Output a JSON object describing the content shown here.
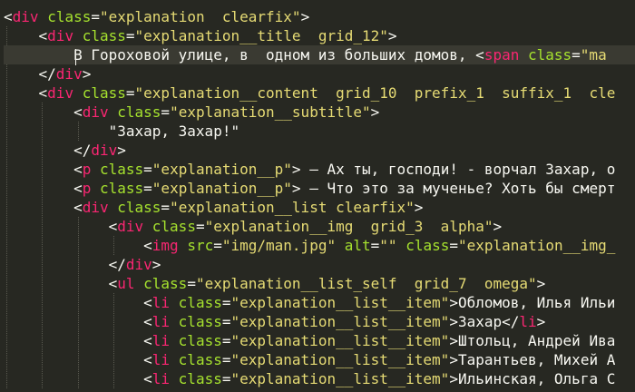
{
  "editor": {
    "colors": {
      "background": "#272822",
      "text": "#f8f8f2",
      "tag": "#f92672",
      "attribute": "#a6e22e",
      "string": "#e6db74"
    },
    "lines": [
      {
        "text": "<div class=\"explanation  clearfix\">"
      },
      {
        "text": "    <div class=\"explanation__title  grid_12\">"
      },
      {
        "text": "        В Гороховой улице, в  одном из больших домов, <span class=\"ma"
      },
      {
        "text": "    </div>"
      },
      {
        "text": "    <div class=\"explanation__content  grid_10  prefix_1  suffix_1  cle"
      },
      {
        "text": "        <div class=\"explanation__subtitle\">"
      },
      {
        "text": "            \"Захар, Захар!\""
      },
      {
        "text": "        </div>"
      },
      {
        "text": "        <p class=\"explanation__p\"> — Ах ты, господи! - ворчал Захар, о"
      },
      {
        "text": "        <p class=\"explanation__p\"> — Что это за мученье? Хоть бы смерт"
      },
      {
        "text": "        <div class=\"explanation__list clearfix\">"
      },
      {
        "text": "            <div class=\"explanation__img  grid_3  alpha\">"
      },
      {
        "text": "                <img src=\"img/man.jpg\" alt=\"\" class=\"explanation__img_"
      },
      {
        "text": "            </div>"
      },
      {
        "text": "            <ul class=\"explanation__list_self  grid_7  omega\">"
      },
      {
        "text": "                <li class=\"explanation__list__item\">Обломов, Илья Ильи"
      },
      {
        "text": "                <li class=\"explanation__list__item\">Захар</li>"
      },
      {
        "text": "                <li class=\"explanation__list__item\">Штольц, Андрей Ива"
      },
      {
        "text": "                <li class=\"explanation__list__item\">Тарантьев, Михей А"
      },
      {
        "text": "                <li class=\"explanation__list__item\">Ильинская, Ольга С"
      }
    ]
  }
}
